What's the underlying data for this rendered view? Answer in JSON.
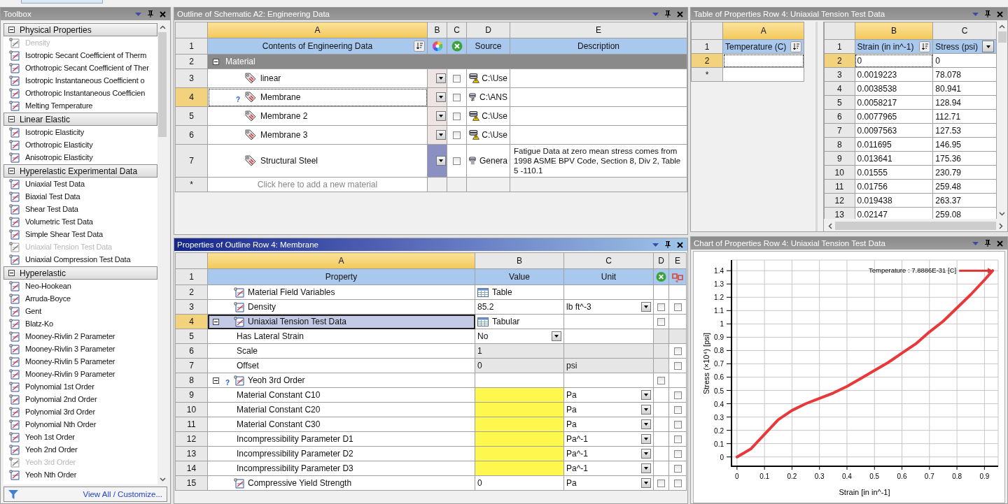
{
  "toolbox": {
    "title": "Toolbox",
    "active": false,
    "groups": [
      {
        "label": "Physical Properties",
        "expanded": true,
        "items": [
          {
            "label": "Density",
            "disabled": true
          },
          {
            "label": "Isotropic Secant Coefficient of Therm",
            "disabled": false
          },
          {
            "label": "Orthotropic Secant Coefficient of Ther",
            "disabled": false
          },
          {
            "label": "Isotropic Instantaneous Coefficient o",
            "disabled": false
          },
          {
            "label": "Orthotropic Instantaneous Coefficien",
            "disabled": false
          },
          {
            "label": "Melting Temperature",
            "disabled": false
          }
        ]
      },
      {
        "label": "Linear Elastic",
        "expanded": true,
        "items": [
          {
            "label": "Isotropic Elasticity",
            "disabled": false
          },
          {
            "label": "Orthotropic Elasticity",
            "disabled": false
          },
          {
            "label": "Anisotropic Elasticity",
            "disabled": false
          }
        ]
      },
      {
        "label": "Hyperelastic Experimental Data",
        "expanded": true,
        "items": [
          {
            "label": "Uniaxial Test Data",
            "disabled": false
          },
          {
            "label": "Biaxial Test Data",
            "disabled": false
          },
          {
            "label": "Shear Test Data",
            "disabled": false
          },
          {
            "label": "Volumetric Test Data",
            "disabled": false
          },
          {
            "label": "Simple Shear Test Data",
            "disabled": false
          },
          {
            "label": "Uniaxial Tension Test Data",
            "disabled": true
          },
          {
            "label": "Uniaxial Compression Test Data",
            "disabled": false
          }
        ]
      },
      {
        "label": "Hyperelastic",
        "expanded": true,
        "items": [
          {
            "label": "Neo-Hookean",
            "disabled": false
          },
          {
            "label": "Arruda-Boyce",
            "disabled": false
          },
          {
            "label": "Gent",
            "disabled": false
          },
          {
            "label": "Blatz-Ko",
            "disabled": false
          },
          {
            "label": "Mooney-Rivlin 2 Parameter",
            "disabled": false
          },
          {
            "label": "Mooney-Rivlin 3 Parameter",
            "disabled": false
          },
          {
            "label": "Mooney-Rivlin 5 Parameter",
            "disabled": false
          },
          {
            "label": "Mooney-Rivlin 9 Parameter",
            "disabled": false
          },
          {
            "label": "Polynomial 1st Order",
            "disabled": false
          },
          {
            "label": "Polynomial 2nd Order",
            "disabled": false
          },
          {
            "label": "Polynomial 3rd Order",
            "disabled": false
          },
          {
            "label": "Polynomial Nth Order",
            "disabled": false
          },
          {
            "label": "Yeoh 1st Order",
            "disabled": false
          },
          {
            "label": "Yeoh 2nd Order",
            "disabled": false
          },
          {
            "label": "Yeoh 3rd Order",
            "disabled": true
          },
          {
            "label": "Yeoh Nth Order",
            "disabled": false
          }
        ]
      }
    ],
    "footer_link": "View All / Customize..."
  },
  "outline": {
    "title": "Outline of Schematic A2: Engineering Data",
    "active": false,
    "header_num": "1",
    "columns": [
      {
        "letter": "A",
        "selected": true,
        "title": "Contents of Engineering Data",
        "kind": "sort"
      },
      {
        "letter": "B",
        "selected": false,
        "kind": "color"
      },
      {
        "letter": "C",
        "selected": false,
        "kind": "suppress"
      },
      {
        "letter": "D",
        "selected": false,
        "title": "Source",
        "kind": "plain"
      },
      {
        "letter": "E",
        "selected": false,
        "title": "Description",
        "kind": "plain"
      }
    ],
    "rows": [
      {
        "num": "2",
        "kind": "group",
        "name": "Material",
        "expanded": true,
        "selected": false
      },
      {
        "num": "3",
        "kind": "material",
        "name": "linear",
        "selected": false,
        "color": "#efe4e4",
        "checked": false,
        "source": {
          "kind": "warning",
          "path": "C:\\Use"
        }
      },
      {
        "num": "4",
        "kind": "material",
        "name": "Membrane",
        "selected": true,
        "unresolved_mark": "?",
        "color": "#efe4e4",
        "checked": false,
        "source": {
          "kind": "changed",
          "path": "C:\\ANS"
        }
      },
      {
        "num": "5",
        "kind": "material",
        "name": "Membrane 2",
        "selected": false,
        "color": "#efe4e4",
        "checked": false,
        "source": {
          "kind": "warning",
          "path": "C:\\Use"
        }
      },
      {
        "num": "6",
        "kind": "material",
        "name": "Membrane 3",
        "selected": false,
        "color": "#efe4e4",
        "checked": false,
        "source": {
          "kind": "warning",
          "path": "C:\\Use"
        }
      },
      {
        "num": "7",
        "kind": "material",
        "name": "Structural Steel",
        "selected": false,
        "color": "#8b90c2",
        "checked": false,
        "source": {
          "kind": "linked",
          "path": "Genera"
        },
        "description": "Fatigue Data at zero mean stress comes from 1998 ASME BPV Code, Section 8, Div 2, Table 5 -110.1"
      },
      {
        "num": "*",
        "kind": "new",
        "name": "Click here to add a new material",
        "selected": false
      }
    ]
  },
  "properties": {
    "title": "Properties of Outline Row 4: Membrane",
    "active": true,
    "header_num": "1",
    "columns": [
      {
        "letter": "A",
        "selected": true,
        "title": "Property",
        "kind": "plain"
      },
      {
        "letter": "B",
        "selected": false,
        "title": "Value",
        "kind": "plain"
      },
      {
        "letter": "C",
        "selected": false,
        "title": "Unit",
        "kind": "plain"
      },
      {
        "letter": "D",
        "selected": false,
        "kind": "suppress"
      },
      {
        "letter": "E",
        "selected": false,
        "kind": "reset"
      }
    ],
    "rows": [
      {
        "num": "2",
        "kind": "property",
        "label": "Material Field Variables",
        "selected": false,
        "value": {
          "kind": "table",
          "text": "Table"
        }
      },
      {
        "num": "3",
        "kind": "property",
        "label": "Density",
        "selected": false,
        "value": {
          "kind": "text",
          "text": "85.2"
        },
        "unit": "lb ft^-3",
        "unit_select": true,
        "d": {
          "checked": false
        },
        "e": {
          "checked": false
        }
      },
      {
        "num": "4",
        "kind": "property",
        "label": "Uniaxial Tension Test Data",
        "selected": true,
        "expanded": true,
        "value": {
          "kind": "table",
          "text": "Tabular"
        },
        "d": {
          "checked": false
        },
        "children": [
          {
            "num": "5",
            "kind": "parameter",
            "label": "Has Lateral Strain",
            "selected": false,
            "value": {
              "kind": "select",
              "text": "No"
            },
            "shaded": true
          },
          {
            "num": "6",
            "kind": "parameter",
            "label": "Scale",
            "selected": false,
            "value": {
              "kind": "text",
              "text": "1"
            },
            "readonly": true,
            "shaded": true,
            "e": {
              "checked": false
            }
          },
          {
            "num": "7",
            "kind": "parameter",
            "label": "Offset",
            "selected": false,
            "value": {
              "kind": "text",
              "text": "0"
            },
            "unit": "psi",
            "readonly": true,
            "shaded": true,
            "e": {
              "checked": false
            }
          }
        ]
      },
      {
        "num": "8",
        "kind": "property",
        "label": "Yeoh 3rd Order",
        "selected": false,
        "expanded": true,
        "unresolved_mark": "?",
        "d": {
          "checked": false
        },
        "children": [
          {
            "num": "9",
            "kind": "parameter",
            "label": "Material Constant C10",
            "selected": false,
            "value": {
              "kind": "required"
            },
            "unit": "Pa",
            "unit_select": true,
            "e": {
              "checked": false
            }
          },
          {
            "num": "10",
            "kind": "parameter",
            "label": "Material Constant C20",
            "selected": false,
            "value": {
              "kind": "required"
            },
            "unit": "Pa",
            "unit_select": true,
            "e": {
              "checked": false
            }
          },
          {
            "num": "11",
            "kind": "parameter",
            "label": "Material Constant C30",
            "selected": false,
            "value": {
              "kind": "required"
            },
            "unit": "Pa",
            "unit_select": true,
            "e": {
              "checked": false
            }
          },
          {
            "num": "12",
            "kind": "parameter",
            "label": "Incompressibility Parameter D1",
            "selected": false,
            "value": {
              "kind": "required"
            },
            "unit": "Pa^-1",
            "unit_select": true,
            "e": {
              "checked": false
            }
          },
          {
            "num": "13",
            "kind": "parameter",
            "label": "Incompressibility Parameter D2",
            "selected": false,
            "value": {
              "kind": "required"
            },
            "unit": "Pa^-1",
            "unit_select": true,
            "e": {
              "checked": false
            }
          },
          {
            "num": "14",
            "kind": "parameter",
            "label": "Incompressibility Parameter D3",
            "selected": false,
            "value": {
              "kind": "required"
            },
            "unit": "Pa^-1",
            "unit_select": true,
            "e": {
              "checked": false
            }
          }
        ]
      },
      {
        "num": "15",
        "kind": "property",
        "label": "Compressive Yield Strength",
        "selected": false,
        "value": {
          "kind": "text",
          "text": "0"
        },
        "unit": "Pa",
        "unit_select": true,
        "d": {
          "checked": false
        },
        "e": {
          "checked": false
        }
      }
    ]
  },
  "table": {
    "title": "Table of Properties Row 4: Uniaxial Tension Test Data",
    "active": false,
    "left": {
      "header_num": "1",
      "column": {
        "letter": "A",
        "selected": true,
        "title": "Temperature (C)",
        "kind": "sort"
      },
      "rows": [
        {
          "num": "2",
          "selected": true
        }
      ],
      "new_row": "*"
    },
    "right": {
      "header_num": "1",
      "columns": [
        {
          "letter": "B",
          "selected": true,
          "title": "Strain (in in^-1)",
          "kind": "sort"
        },
        {
          "letter": "C",
          "selected": false,
          "title": "Stress (psi)",
          "kind": "menu"
        }
      ],
      "rows": [
        {
          "num": "2",
          "strain": "0",
          "stress": "0",
          "selected": true
        },
        {
          "num": "3",
          "strain": "0.0019223",
          "stress": "78.078",
          "selected": false
        },
        {
          "num": "4",
          "strain": "0.0038538",
          "stress": "80.941",
          "selected": false
        },
        {
          "num": "5",
          "strain": "0.0058217",
          "stress": "128.94",
          "selected": false
        },
        {
          "num": "6",
          "strain": "0.0077965",
          "stress": "112.71",
          "selected": false
        },
        {
          "num": "7",
          "strain": "0.0097563",
          "stress": "127.53",
          "selected": false
        },
        {
          "num": "8",
          "strain": "0.011695",
          "stress": "146.95",
          "selected": false
        },
        {
          "num": "9",
          "strain": "0.013641",
          "stress": "175.36",
          "selected": false
        },
        {
          "num": "10",
          "strain": "0.01555",
          "stress": "230.79",
          "selected": false
        },
        {
          "num": "11",
          "strain": "0.01756",
          "stress": "259.48",
          "selected": false
        },
        {
          "num": "12",
          "strain": "0.019438",
          "stress": "263.37",
          "selected": false
        },
        {
          "num": "13",
          "strain": "0.02147",
          "stress": "259.08",
          "selected": false
        }
      ]
    }
  },
  "chart": {
    "title": "Chart of Properties Row 4: Uniaxial Tension Test Data",
    "active": false,
    "chart_data": {
      "type": "line",
      "xlabel": "Strain  [in in^-1]",
      "ylabel": "Stress  (×10⁴)  [psi]",
      "grid": true,
      "xlim": [
        -0.02,
        0.95
      ],
      "ylim": [
        -0.07,
        1.48
      ],
      "x": [
        0,
        0.05,
        0.1,
        0.15,
        0.2,
        0.25,
        0.3,
        0.35,
        0.4,
        0.45,
        0.5,
        0.55,
        0.6,
        0.65,
        0.7,
        0.75,
        0.8,
        0.85,
        0.9,
        0.93
      ],
      "annotations": [
        "Temperature : 7.8886E-31 [C]"
      ],
      "series": [
        {
          "color": "#e8383a",
          "values": [
            0,
            0.06,
            0.17,
            0.28,
            0.35,
            0.4,
            0.44,
            0.48,
            0.53,
            0.59,
            0.65,
            0.71,
            0.78,
            0.85,
            0.94,
            1.02,
            1.12,
            1.22,
            1.33,
            1.4
          ]
        }
      ],
      "xticks": [
        0,
        0.1,
        0.2,
        0.3,
        0.4,
        0.5,
        0.6,
        0.7,
        0.8,
        0.9
      ],
      "yticks": [
        0,
        0.1,
        0.2,
        0.3,
        0.4,
        0.5,
        0.6,
        0.7,
        0.8,
        0.9,
        1,
        1.1,
        1.2,
        1.3,
        1.4
      ]
    }
  }
}
